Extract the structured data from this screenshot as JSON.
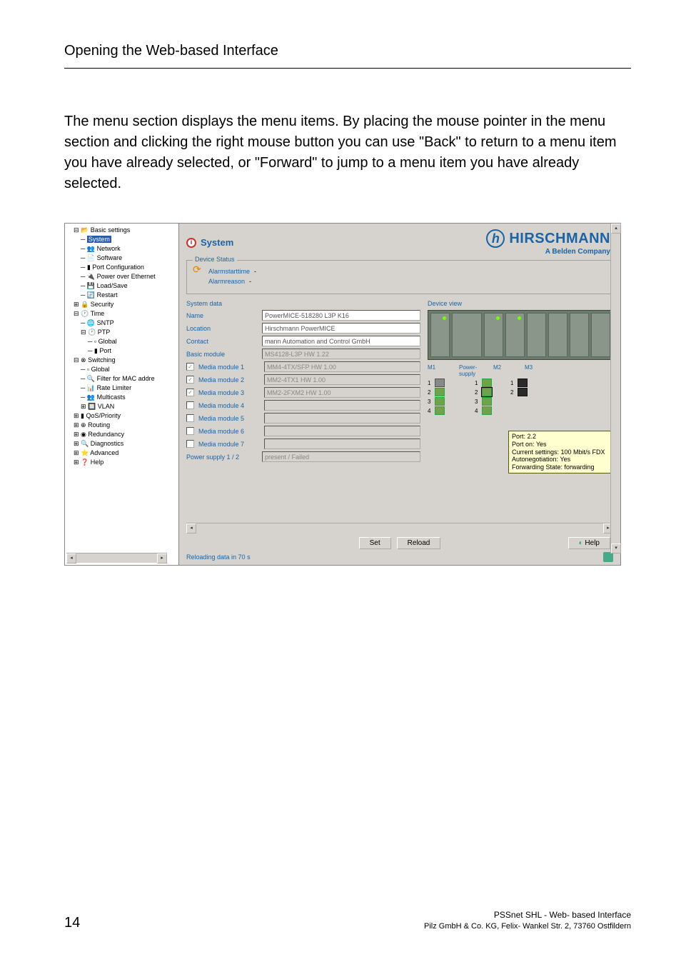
{
  "page": {
    "header": "Opening the Web-based Interface",
    "paragraph": "The menu section displays the menu items. By placing the mouse pointer in the menu section and clicking the right mouse button you can use \"Back\" to return to a menu item you have already selected, or \"Forward\" to jump to a menu item you have already selected.",
    "page_number": "14",
    "footer_line1": "PSSnet SHL - Web- based Interface",
    "footer_line2": "Pilz GmbH & Co. KG, Felix- Wankel Str. 2, 73760 Ostfildern"
  },
  "tree": {
    "items": [
      {
        "label": "Basic settings",
        "children": [
          {
            "label": "System",
            "selected": true
          },
          {
            "label": "Network"
          },
          {
            "label": "Software"
          },
          {
            "label": "Port Configuration"
          },
          {
            "label": "Power over Ethernet"
          },
          {
            "label": "Load/Save"
          },
          {
            "label": "Restart"
          }
        ]
      },
      {
        "label": "Security"
      },
      {
        "label": "Time",
        "children": [
          {
            "label": "SNTP"
          },
          {
            "label": "PTP",
            "children": [
              {
                "label": "Global"
              },
              {
                "label": "Port"
              }
            ]
          }
        ]
      },
      {
        "label": "Switching",
        "children": [
          {
            "label": "Global"
          },
          {
            "label": "Filter for MAC addre"
          },
          {
            "label": "Rate Limiter"
          },
          {
            "label": "Multicasts"
          },
          {
            "label": "VLAN"
          }
        ]
      },
      {
        "label": "QoS/Priority"
      },
      {
        "label": "Routing"
      },
      {
        "label": "Redundancy"
      },
      {
        "label": "Diagnostics"
      },
      {
        "label": "Advanced"
      },
      {
        "label": "Help"
      }
    ]
  },
  "content": {
    "title": "System",
    "brand": "HIRSCHMANN",
    "brand_sub": "A Belden Company",
    "device_status_title": "Device Status",
    "alarm_start_label": "Alarmstarttime",
    "alarm_reason_label": "Alarmreason",
    "system_data_title": "System data",
    "device_view_title": "Device view",
    "fields": {
      "name_label": "Name",
      "name_value": "PowerMICE-518280 L3P K16",
      "location_label": "Location",
      "location_value": "Hirschmann PowerMICE",
      "contact_label": "Contact",
      "contact_value": "mann Automation and Control GmbH",
      "basic_label": "Basic module",
      "basic_value": "MS4128-L3P HW 1.22",
      "m1_label": "Media module 1",
      "m1_value": "MM4-4TX/SFP HW 1.00",
      "m2_label": "Media module 2",
      "m2_value": "MM2-4TX1 HW 1.00",
      "m3_label": "Media module 3",
      "m3_value": "MM2-2FXM2 HW 1.00",
      "m4_label": "Media module 4",
      "m5_label": "Media module 5",
      "m6_label": "Media module 6",
      "m7_label": "Media module 7",
      "ps_label": "Power supply 1 / 2",
      "ps_value": "present / Failed"
    },
    "dv_cols": {
      "m1": "M1",
      "ps": "Power-\nsupply",
      "m2": "M2",
      "m3": "M3"
    },
    "tooltip": {
      "l1": "Port: 2.2",
      "l2": "Port on: Yes",
      "l3": "Current settings: 100 Mbit/s FDX",
      "l4": "Autonegotiation: Yes",
      "l5": "Forwarding State: forwarding"
    },
    "buttons": {
      "set": "Set",
      "reload": "Reload",
      "help": "Help"
    },
    "status": "Reloading data in 70 s"
  }
}
